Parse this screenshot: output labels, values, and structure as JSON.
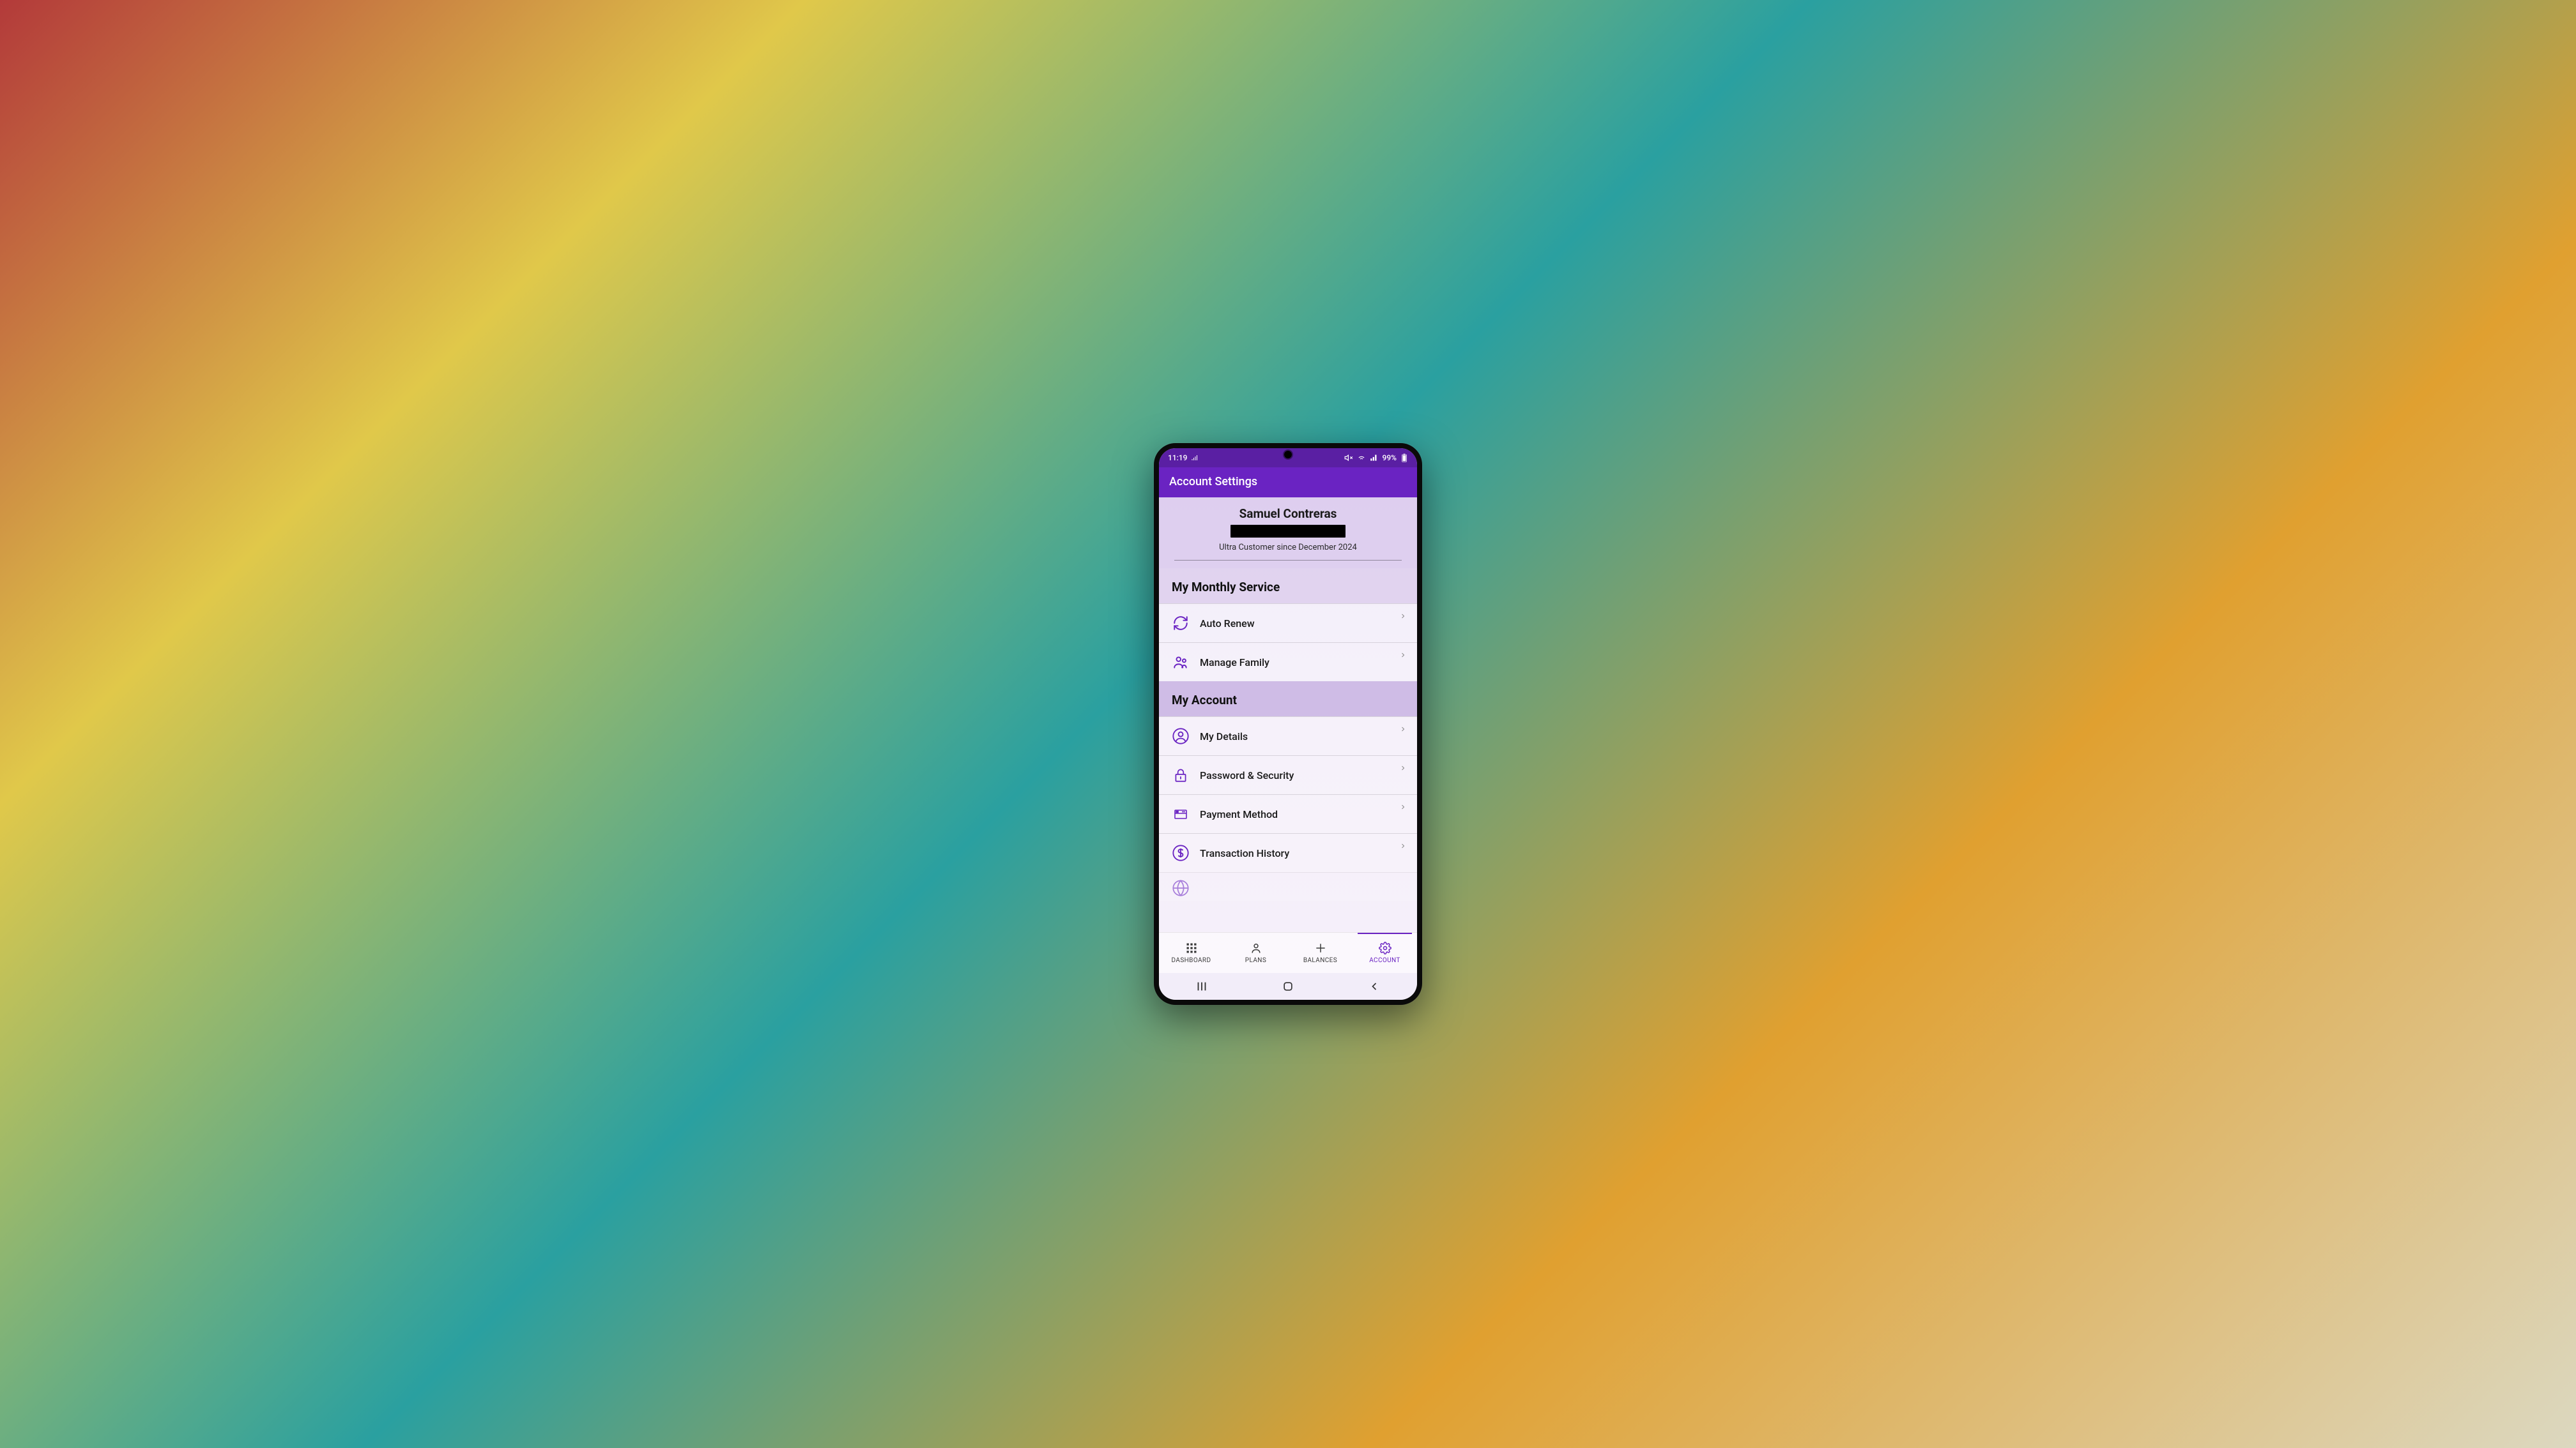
{
  "status": {
    "time": "11:19",
    "battery": "99%"
  },
  "appbar": {
    "title": "Account Settings"
  },
  "profile": {
    "name": "Samuel Contreras",
    "since": "Ultra Customer since December 2024"
  },
  "sections": {
    "monthly": {
      "title": "My Monthly Service",
      "items": [
        {
          "icon": "refresh-icon",
          "label": "Auto Renew"
        },
        {
          "icon": "family-icon",
          "label": "Manage Family"
        }
      ]
    },
    "account": {
      "title": "My Account",
      "items": [
        {
          "icon": "person-circle-icon",
          "label": "My Details"
        },
        {
          "icon": "lock-icon",
          "label": "Password & Security"
        },
        {
          "icon": "card-icon",
          "label": "Payment Method"
        },
        {
          "icon": "dollar-icon",
          "label": "Transaction History"
        },
        {
          "icon": "globe-icon",
          "label": ""
        }
      ]
    }
  },
  "tabs": [
    {
      "icon": "grid-icon",
      "label": "DASHBOARD",
      "active": false
    },
    {
      "icon": "person-icon",
      "label": "PLANS",
      "active": false
    },
    {
      "icon": "plus-icon",
      "label": "BALANCES",
      "active": false
    },
    {
      "icon": "gear-icon",
      "label": "ACCOUNT",
      "active": true
    }
  ],
  "colors": {
    "brand": "#6a23c2",
    "brandDark": "#5a1fa3"
  }
}
